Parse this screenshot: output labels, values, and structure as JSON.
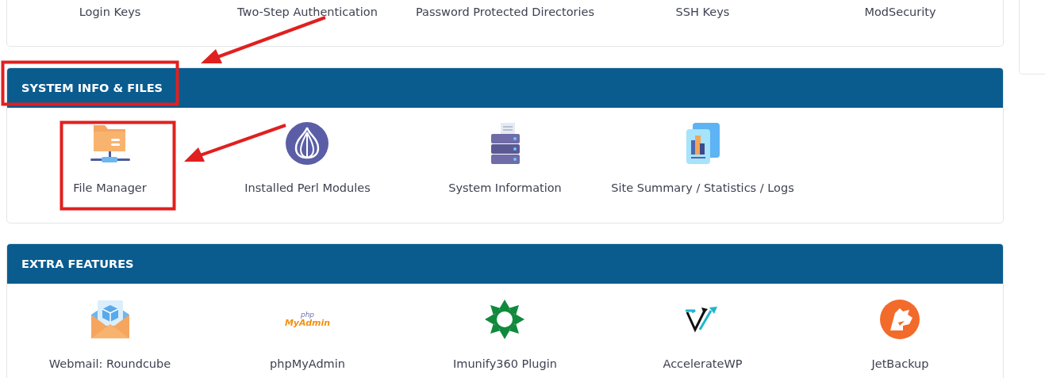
{
  "sections": [
    {
      "items": [
        {
          "label": "Login Keys"
        },
        {
          "label": "Two-Step Authentication"
        },
        {
          "label": "Password Protected Directories"
        },
        {
          "label": "SSH Keys"
        },
        {
          "label": "ModSecurity"
        }
      ]
    },
    {
      "title": "SYSTEM INFO & FILES",
      "items": [
        {
          "label": "File Manager"
        },
        {
          "label": "Installed Perl Modules"
        },
        {
          "label": "System Information"
        },
        {
          "label": "Site Summary / Statistics / Logs"
        }
      ]
    },
    {
      "title": "EXTRA FEATURES",
      "items": [
        {
          "label": "Webmail: Roundcube"
        },
        {
          "label": "phpMyAdmin",
          "logo_top": "php",
          "logo_bottom": "MyAdmin"
        },
        {
          "label": "Imunify360 Plugin"
        },
        {
          "label": "AccelerateWP"
        },
        {
          "label": "JetBackup"
        }
      ]
    }
  ]
}
